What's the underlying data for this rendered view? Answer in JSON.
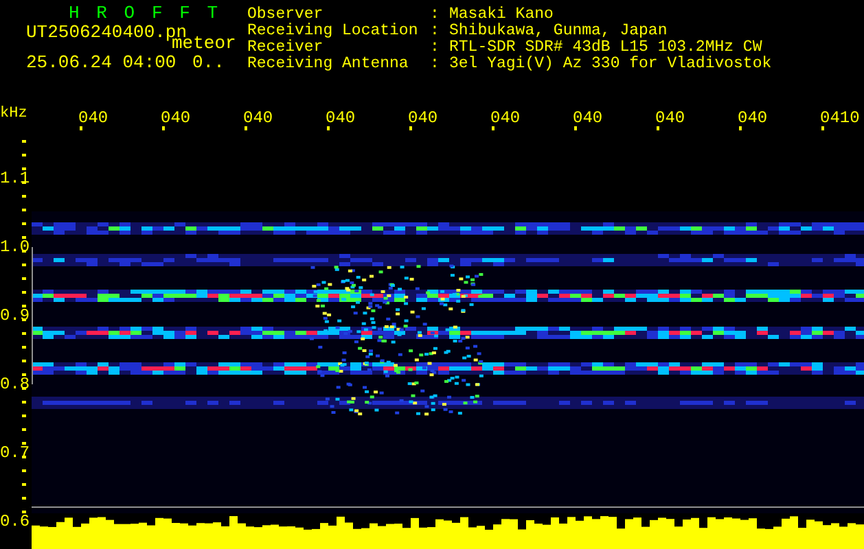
{
  "app_title": "HROFFT",
  "file_name": "UT2506240400.pn",
  "event_type": "meteor",
  "timestamp": "25.06.24 04:00",
  "count": "0..",
  "separator": ":",
  "info": [
    {
      "label": "Observer",
      "value": "Masaki Kano"
    },
    {
      "label": "Receiving Location",
      "value": "Shibukawa, Gunma, Japan"
    },
    {
      "label": "Receiver",
      "value": "RTL-SDR SDR# 43dB L15 103.2MHz CW"
    },
    {
      "label": "Receiving Antenna",
      "value": "3el Yagi(V) Az 330 for Vladivostok"
    }
  ],
  "y_unit": "kHz",
  "time_labels": [
    "040",
    "040",
    "040",
    "040",
    "040",
    "040",
    "040",
    "040",
    "040",
    "0410"
  ],
  "y_labels": [
    "1.1",
    "1.0",
    "0.9",
    "0.8",
    "0.7",
    "0.6"
  ]
}
